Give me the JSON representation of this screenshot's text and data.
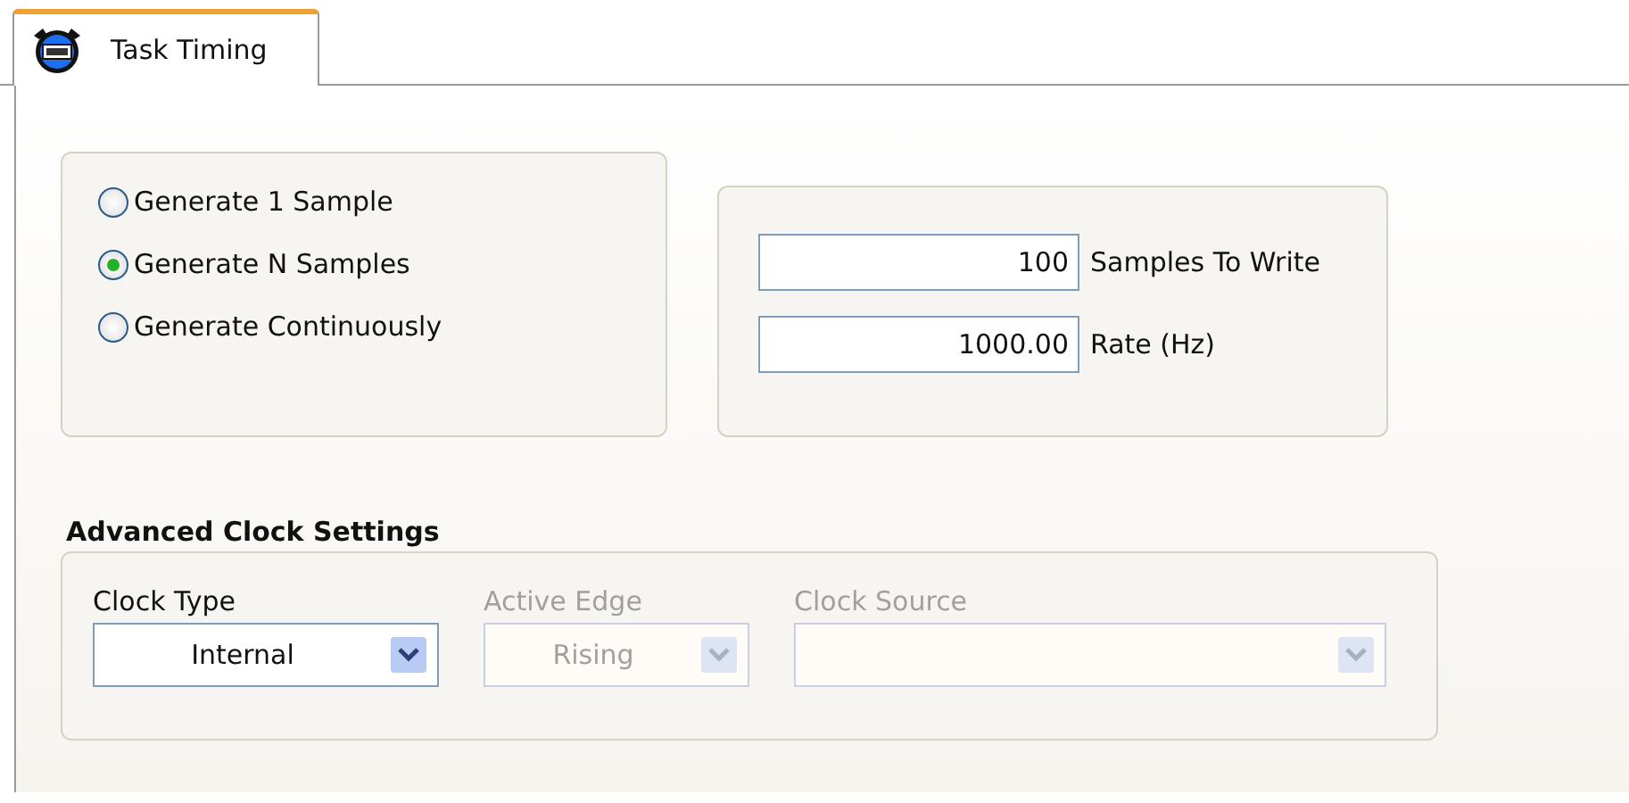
{
  "tabs": [
    {
      "label": "Task Timing",
      "selected": true
    }
  ],
  "sample_modes": [
    {
      "label": "Generate 1 Sample",
      "selected": false
    },
    {
      "label": "Generate N Samples",
      "selected": true
    },
    {
      "label": "Generate Continuously",
      "selected": false
    }
  ],
  "fields": [
    {
      "value": "100",
      "label": "Samples To Write"
    },
    {
      "value": "1000.00",
      "label": "Rate (Hz)"
    }
  ],
  "advanced_clock_settings": {
    "title": "Advanced Clock Settings",
    "dropdowns": [
      {
        "label": "Clock Type",
        "value": "Internal",
        "disabled": false
      },
      {
        "label": "Active Edge",
        "value": "Rising",
        "disabled": true
      },
      {
        "label": "Clock Source",
        "disabled": true
      }
    ]
  }
}
